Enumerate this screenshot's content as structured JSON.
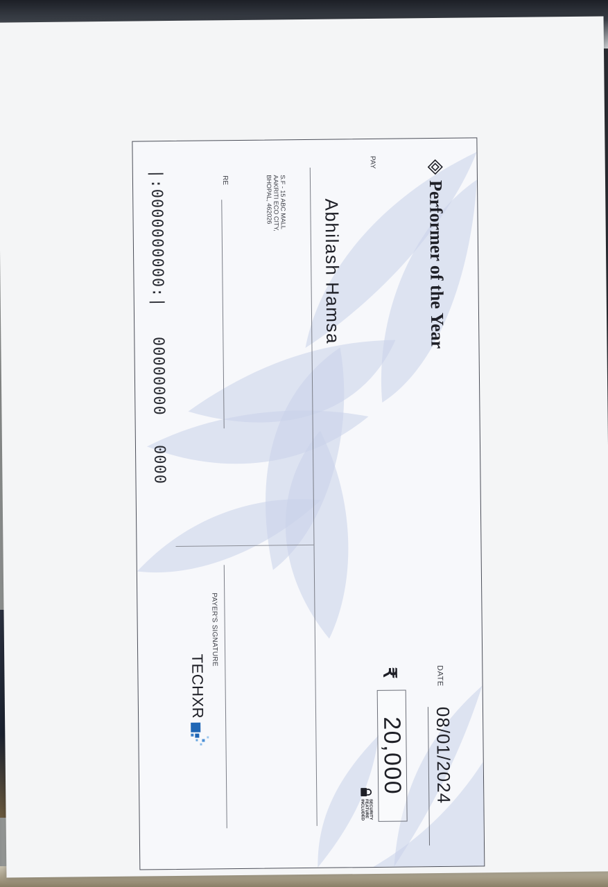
{
  "cheque": {
    "title": "Performer of the Year",
    "pay_label": "PAY",
    "payee": "Abhilash Hamsa",
    "date_label": "DATE",
    "date": "08/01/2024",
    "currency_symbol": "₹",
    "amount": "20,000",
    "security_lines": [
      "SECURITY",
      "FEATURE",
      "INCLUDED"
    ],
    "address_lines": [
      "S.F - 15 ABC MALL",
      "AAKRITI ECO CITY,",
      "BHOPAL, 462026"
    ],
    "re_label": "RE",
    "signature_label": "PAYER'S SIGNATURE",
    "brand": "TECHXR",
    "micr": {
      "account": "|:0000000000:|",
      "number": "00000000",
      "code": "0000"
    }
  },
  "colors": {
    "watermark": "#c9d2ea",
    "ink": "#1e1f26",
    "brand_blue": "#1f66b5"
  }
}
